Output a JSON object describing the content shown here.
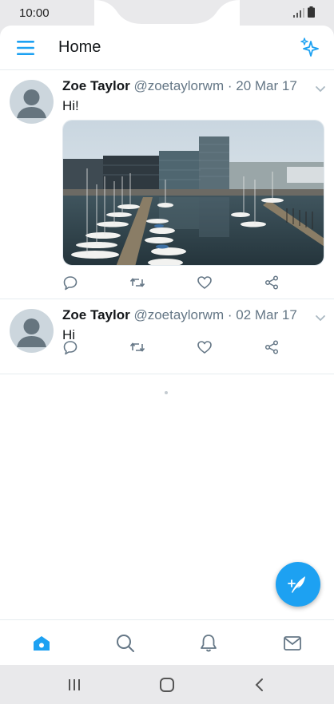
{
  "status_bar": {
    "time": "10:00"
  },
  "header": {
    "title": "Home"
  },
  "tweets": [
    {
      "author": "Zoe Taylor",
      "handle": "@zoetaylorwm",
      "separator": "·",
      "date": "20 Mar 17",
      "text": "Hi!",
      "has_media": true
    },
    {
      "author": "Zoe Taylor",
      "handle": "@zoetaylorwm",
      "separator": "·",
      "date": "02 Mar 17",
      "text": "Hi",
      "has_media": false
    }
  ],
  "icons": {
    "menu": "hamburger-menu-icon",
    "sparkle": "sparkle-icon",
    "reply": "reply-icon",
    "retweet": "retweet-icon",
    "like": "heart-icon",
    "share": "share-icon",
    "compose": "compose-feather-icon",
    "nav": [
      "home-icon",
      "search-icon",
      "bell-icon",
      "mail-icon"
    ],
    "system": [
      "recents-icon",
      "home-circle-icon",
      "back-icon"
    ]
  },
  "colors": {
    "accent": "#1da1f2",
    "text": "#14171a",
    "muted": "#657786",
    "icon": "#657786"
  }
}
